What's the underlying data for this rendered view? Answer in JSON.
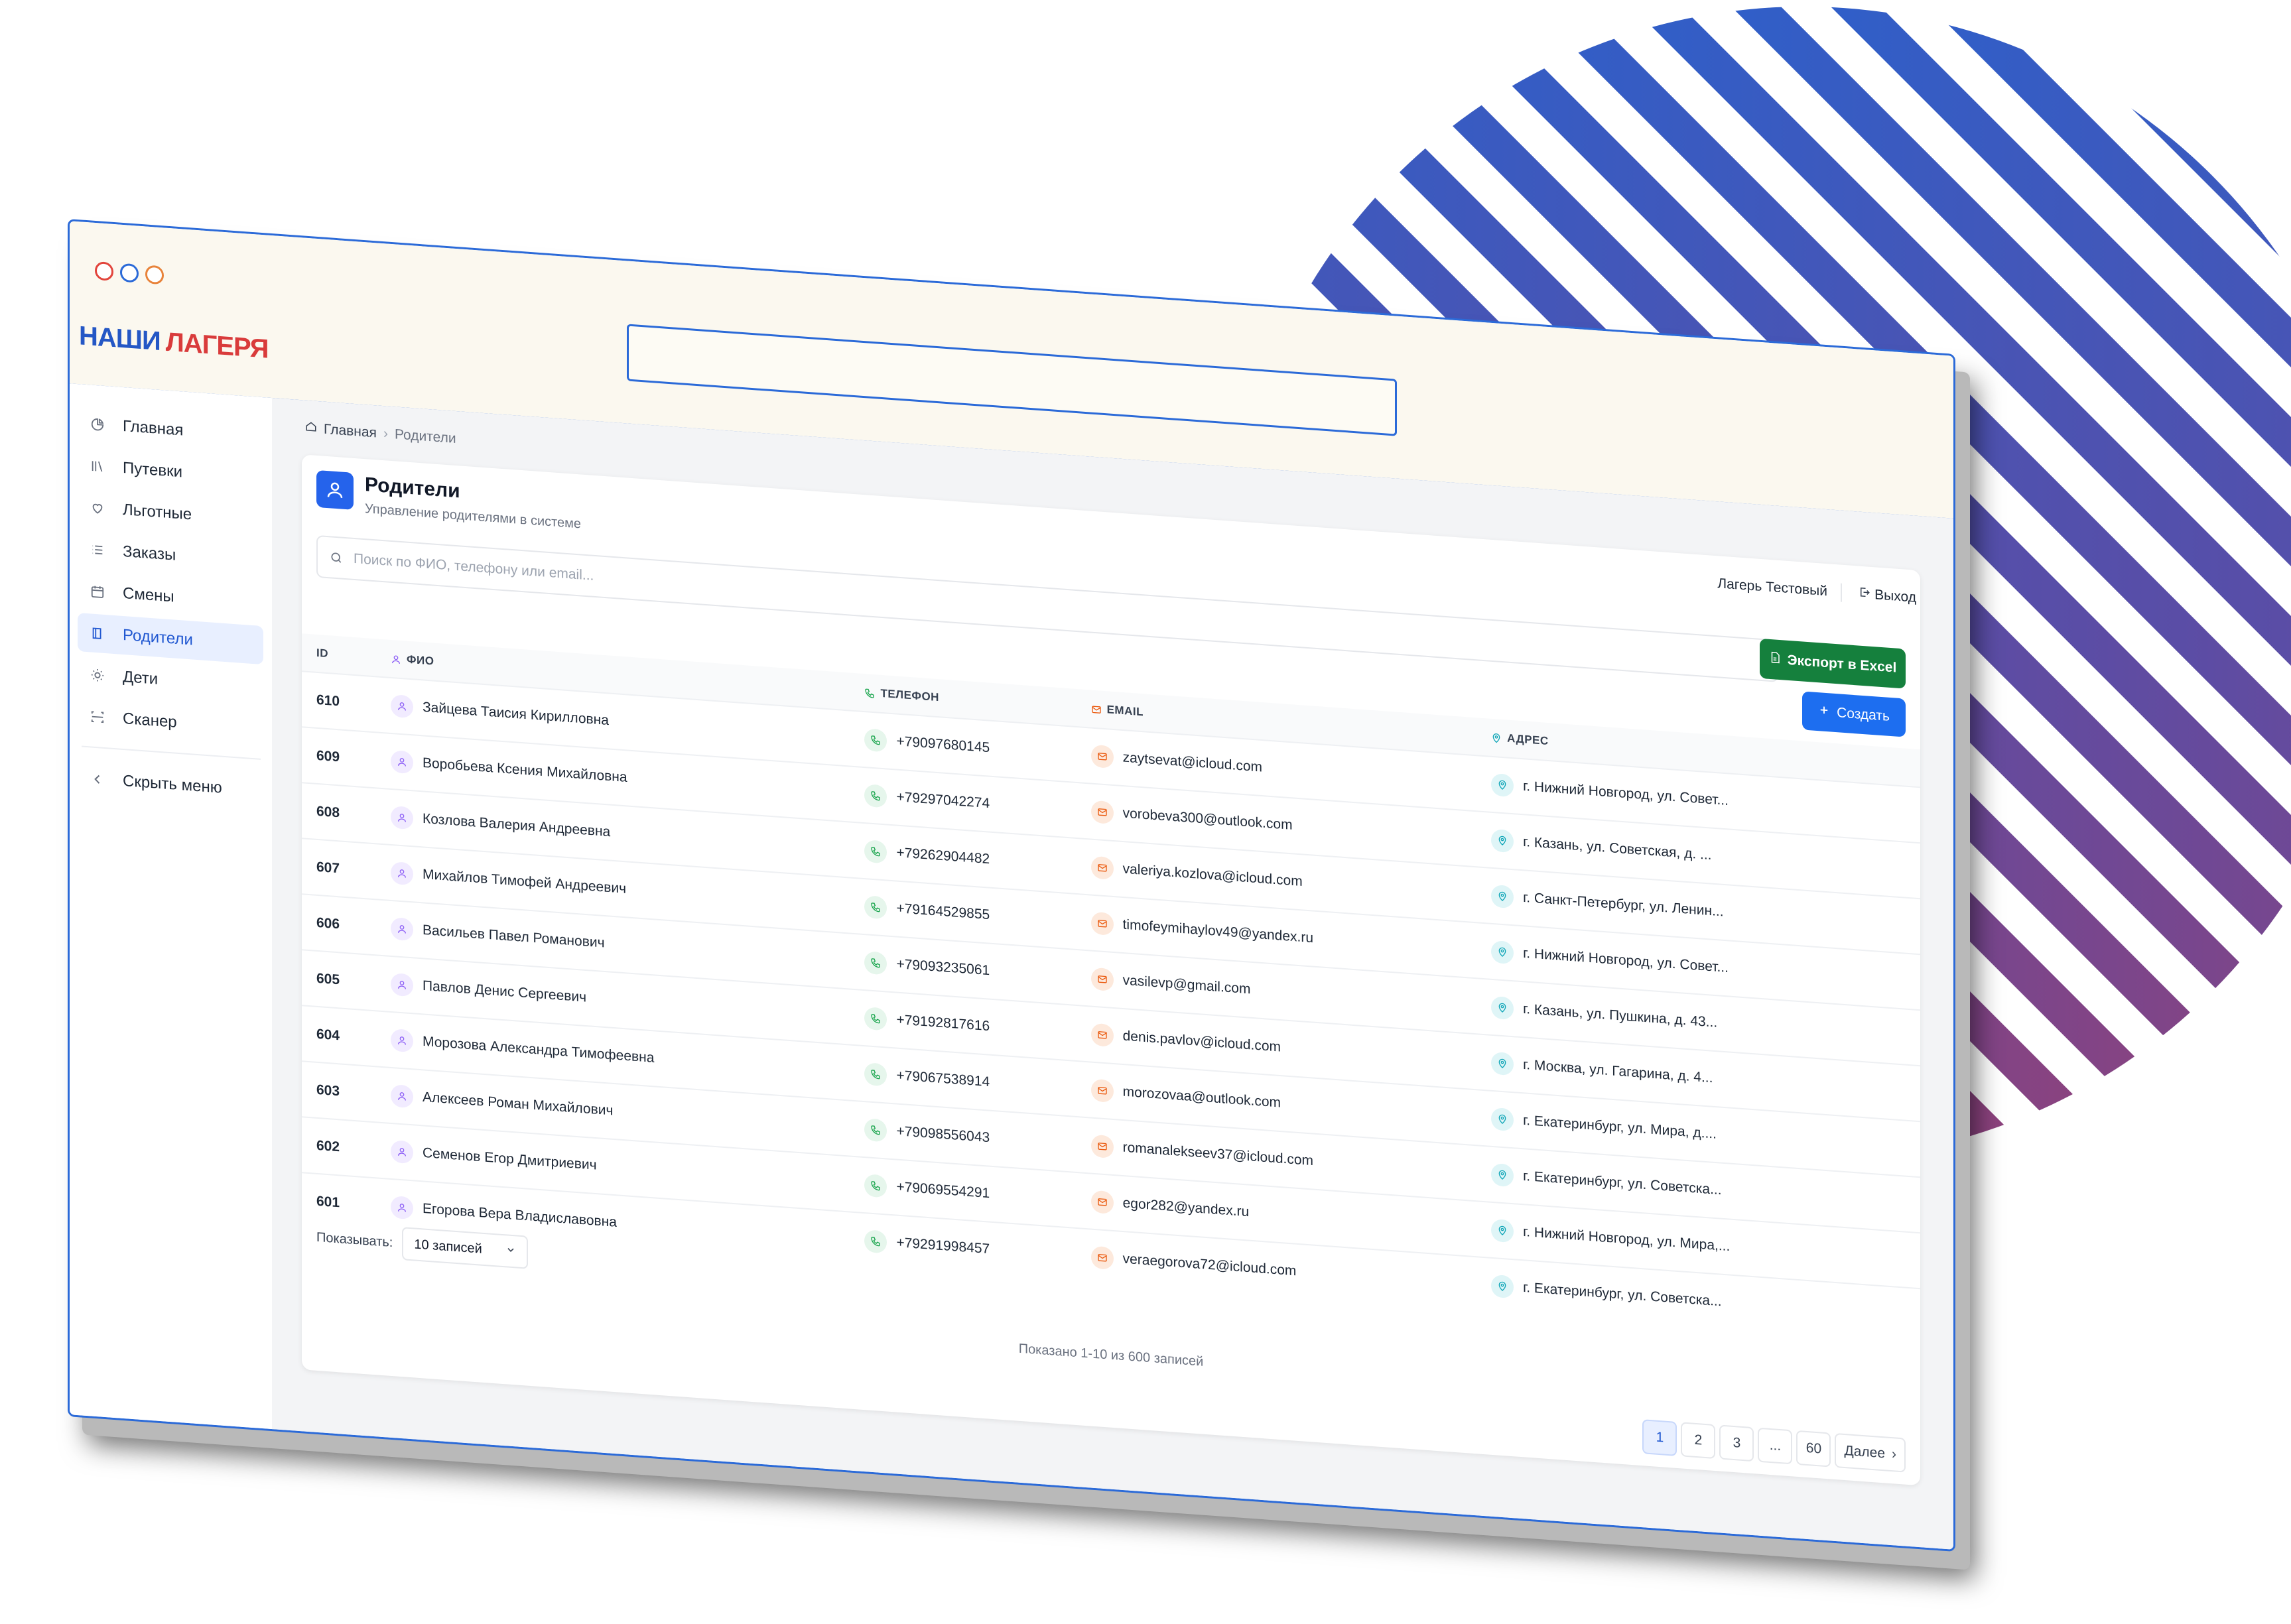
{
  "brand": {
    "part1": "НАШИ",
    "part2": "ЛАГЕРЯ"
  },
  "colors": {
    "accent": "#2563eb",
    "excel": "#15803d",
    "brand_blue": "#2457c5",
    "brand_red": "#d93b3b"
  },
  "sidebar": {
    "items": [
      {
        "label": "Главная",
        "icon": "chart-pie-icon"
      },
      {
        "label": "Путевки",
        "icon": "books-icon"
      },
      {
        "label": "Льготные",
        "icon": "heart-icon"
      },
      {
        "label": "Заказы",
        "icon": "list-icon"
      },
      {
        "label": "Смены",
        "icon": "calendar-icon"
      },
      {
        "label": "Родители",
        "icon": "book-icon",
        "active": true
      },
      {
        "label": "Дети",
        "icon": "sun-icon"
      },
      {
        "label": "Сканер",
        "icon": "scanner-icon"
      }
    ],
    "collapse": "Скрыть меню"
  },
  "breadcrumb": {
    "home": "Главная",
    "current": "Родители"
  },
  "header": {
    "title": "Родители",
    "subtitle": "Управление родителями в системе",
    "camp": "Лагерь Тестовый",
    "logout": "Выход"
  },
  "search": {
    "placeholder": "Поиск по ФИО, телефону или email..."
  },
  "buttons": {
    "export": "Экспорт в Excel",
    "create": "Создать"
  },
  "table": {
    "columns": {
      "id": "ID",
      "name": "ФИО",
      "phone": "ТЕЛЕФОН",
      "email": "EMAIL",
      "address": "АДРЕС"
    },
    "rows": [
      {
        "id": "610",
        "name": "Зайцева Таисия Кирилловна",
        "phone": "+79097680145",
        "email": "zaytsevat@icloud.com",
        "address": "г. Нижний Новгород, ул. Совет..."
      },
      {
        "id": "609",
        "name": "Воробьева Ксения Михайловна",
        "phone": "+79297042274",
        "email": "vorobeva300@outlook.com",
        "address": "г. Казань, ул. Советская, д. ..."
      },
      {
        "id": "608",
        "name": "Козлова Валерия Андреевна",
        "phone": "+79262904482",
        "email": "valeriya.kozlova@icloud.com",
        "address": "г. Санкт-Петербург, ул. Ленин..."
      },
      {
        "id": "607",
        "name": "Михайлов Тимофей Андреевич",
        "phone": "+79164529855",
        "email": "timofeymihaylov49@yandex.ru",
        "address": "г. Нижний Новгород, ул. Совет..."
      },
      {
        "id": "606",
        "name": "Васильев Павел Романович",
        "phone": "+79093235061",
        "email": "vasilevp@gmail.com",
        "address": "г. Казань, ул. Пушкина, д. 43..."
      },
      {
        "id": "605",
        "name": "Павлов Денис Сергеевич",
        "phone": "+79192817616",
        "email": "denis.pavlov@icloud.com",
        "address": "г. Москва, ул. Гагарина, д. 4..."
      },
      {
        "id": "604",
        "name": "Морозова Александра Тимофеевна",
        "phone": "+79067538914",
        "email": "morozovaa@outlook.com",
        "address": "г. Екатеринбург, ул. Мира, д...."
      },
      {
        "id": "603",
        "name": "Алексеев Роман Михайлович",
        "phone": "+79098556043",
        "email": "romanalekseev37@icloud.com",
        "address": "г. Екатеринбург, ул. Советска..."
      },
      {
        "id": "602",
        "name": "Семенов Егор Дмитриевич",
        "phone": "+79069554291",
        "email": "egor282@yandex.ru",
        "address": "г. Нижний Новгород, ул. Мира,..."
      },
      {
        "id": "601",
        "name": "Егорова Вера Владиславовна",
        "phone": "+79291998457",
        "email": "veraegorova72@icloud.com",
        "address": "г. Екатеринбург, ул. Советска..."
      }
    ]
  },
  "footer": {
    "show_label": "Показывать:",
    "page_size": "10 записей",
    "summary": "Показано 1-10 из 600 записей",
    "pages": [
      "1",
      "2",
      "3",
      "...",
      "60"
    ],
    "next": "Далее"
  }
}
